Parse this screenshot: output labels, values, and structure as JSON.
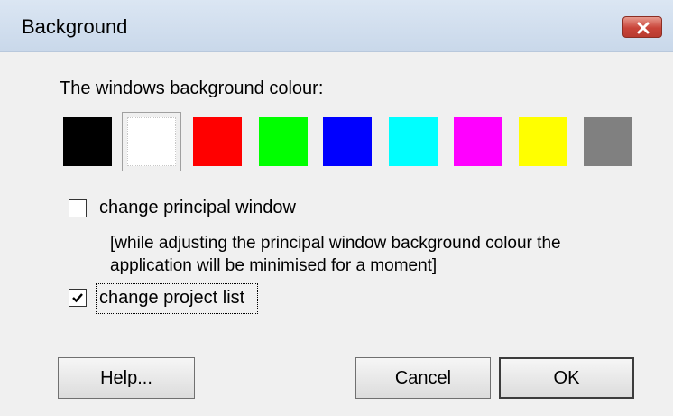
{
  "window": {
    "title": "Background"
  },
  "prompt_label": "The windows background colour:",
  "swatches": [
    {
      "name": "black",
      "color": "#000000"
    },
    {
      "name": "white",
      "color": "#ffffff",
      "selected": true
    },
    {
      "name": "red",
      "color": "#ff0000"
    },
    {
      "name": "green",
      "color": "#00ff00"
    },
    {
      "name": "blue",
      "color": "#0000ff"
    },
    {
      "name": "cyan",
      "color": "#00ffff"
    },
    {
      "name": "magenta",
      "color": "#ff00ff"
    },
    {
      "name": "yellow",
      "color": "#ffff00"
    },
    {
      "name": "gray",
      "color": "#808080"
    }
  ],
  "options": {
    "principal_window": {
      "label": "change principal window",
      "checked": false
    },
    "note_line1": "[while adjusting the principal window background colour the",
    "note_line2": "application will be minimised for a moment]",
    "project_list": {
      "label": "change project list",
      "checked": true
    }
  },
  "buttons": {
    "help": "Help...",
    "cancel": "Cancel",
    "ok": "OK"
  },
  "icons": {
    "close": "close-icon",
    "checkmark": "checkmark-icon"
  }
}
